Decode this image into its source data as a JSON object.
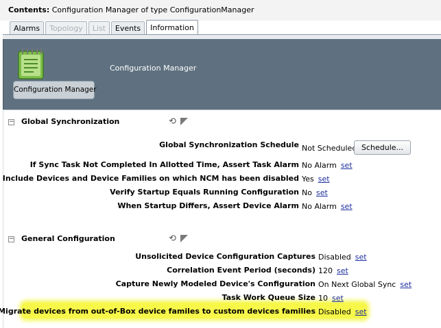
{
  "header": {
    "contents_label": "Contents:",
    "contents_text": "Configuration Manager of type ConfigurationManager"
  },
  "tabs": [
    {
      "label": "Alarms",
      "state": "normal"
    },
    {
      "label": "Topology",
      "state": "disabled"
    },
    {
      "label": "List",
      "state": "disabled"
    },
    {
      "label": "Events",
      "state": "normal"
    },
    {
      "label": "Information",
      "state": "active"
    }
  ],
  "banner": {
    "icon": "notebook-icon",
    "button_label": "Configuration Manager",
    "title": "Configuration Manager"
  },
  "sections": {
    "global": {
      "title": "Global Synchronization",
      "toggle": "−",
      "icons": [
        "refresh-icon",
        "flag-icon"
      ],
      "rows": [
        {
          "label": "Global Synchronization Schedule",
          "value": "Not Scheduled",
          "action": "Schedule..."
        },
        {
          "label": "If Sync Task Not Completed In Allotted Time, Assert Task Alarm",
          "value": "No Alarm",
          "action": "set"
        },
        {
          "label": "Include Devices and Device Families on which NCM has been disabled",
          "value": "Yes",
          "action": "set"
        },
        {
          "label": "Verify Startup Equals Running Configuration",
          "value": "No",
          "action": "set"
        },
        {
          "label": "When Startup Differs, Assert Device Alarm",
          "value": "No Alarm",
          "action": "set"
        }
      ]
    },
    "general": {
      "title": "General Configuration",
      "toggle": "−",
      "icons": [
        "refresh-icon",
        "flag-icon"
      ],
      "rows": [
        {
          "label": "Unsolicited Device Configuration Captures",
          "value": "Disabled",
          "action": "set"
        },
        {
          "label": "Correlation Event Period (seconds)",
          "value": "120",
          "action": "set"
        },
        {
          "label": "Capture Newly Modeled Device's Configuration",
          "value": "On Next Global Sync",
          "action": "set"
        },
        {
          "label": "Task Work Queue Size",
          "value": "10",
          "action": "set"
        },
        {
          "label": "Migrate devices from out-of-Box device familes to custom devices families",
          "value": "Disabled",
          "action": "set",
          "highlighted": true
        }
      ]
    }
  },
  "colors": {
    "banner": "#5f7180",
    "highlight": "#f7f74a",
    "link": "#1d2f9e"
  }
}
